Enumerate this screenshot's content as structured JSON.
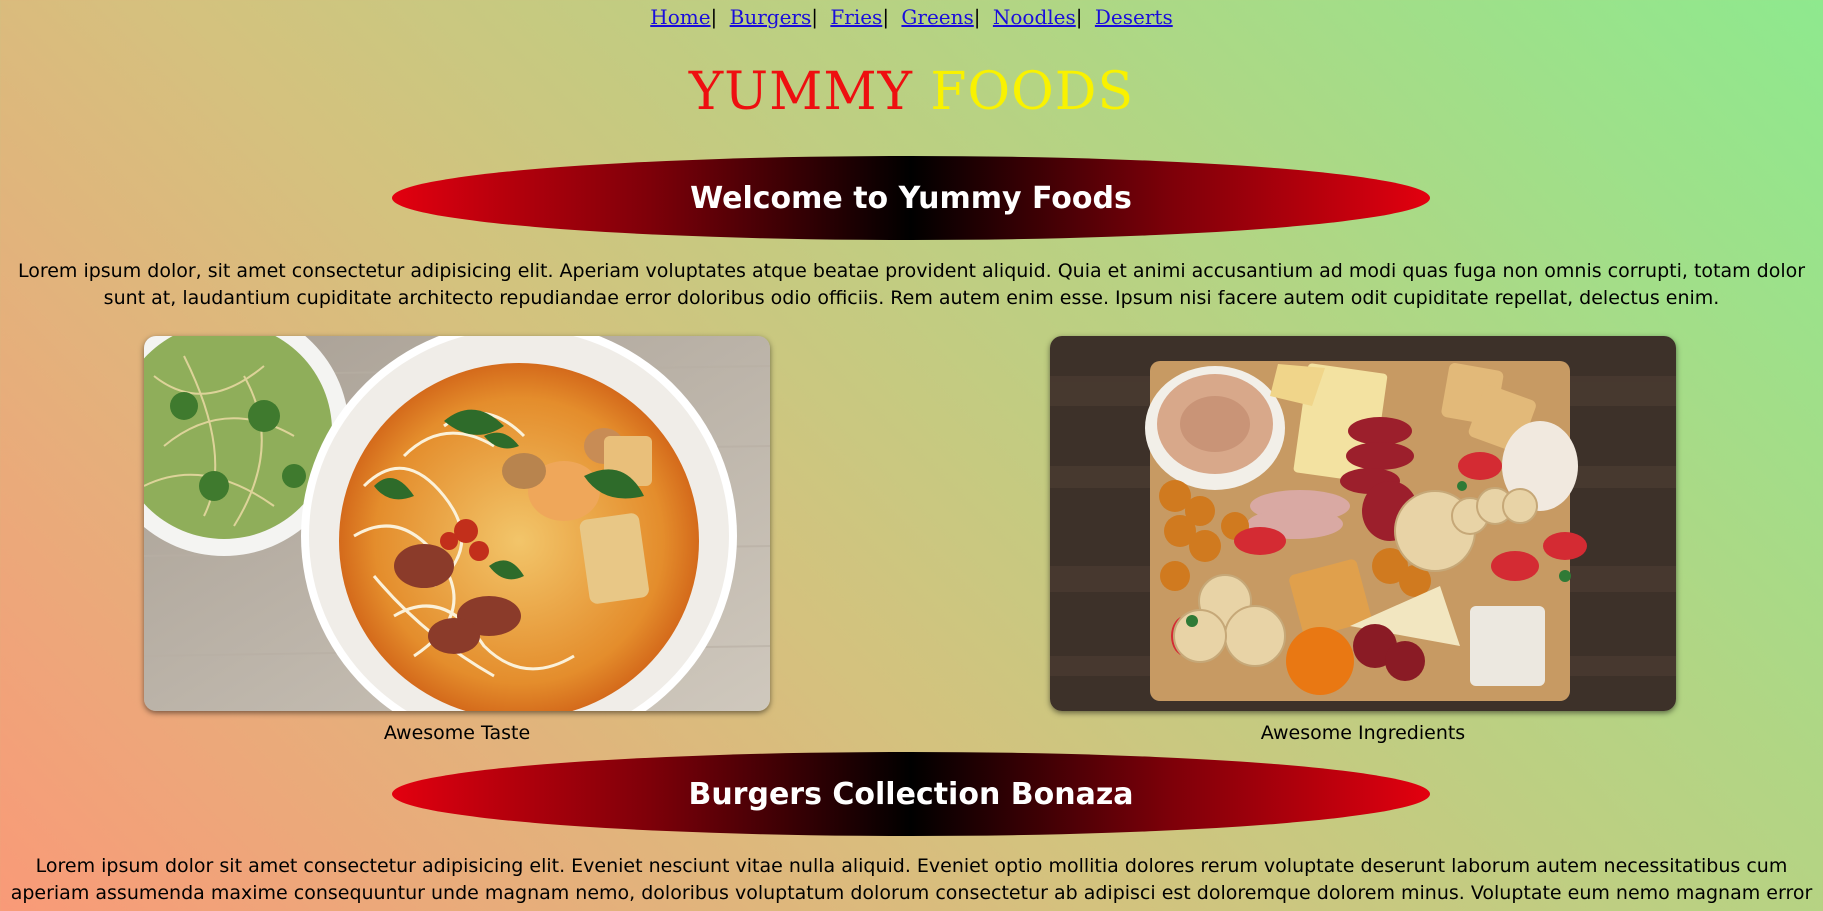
{
  "nav": {
    "items": [
      {
        "label": "Home"
      },
      {
        "label": "Burgers"
      },
      {
        "label": "Fries"
      },
      {
        "label": "Greens"
      },
      {
        "label": "Noodles"
      },
      {
        "label": "Deserts"
      }
    ],
    "separator": "|"
  },
  "logo": {
    "word1": "YUMMY",
    "word2": "FOODS",
    "word1_color": "#ee0f10",
    "word2_color": "#f9f200"
  },
  "sections": [
    {
      "heading": "Welcome to Yummy Foods",
      "text": "Lorem ipsum dolor, sit amet consectetur adipisicing elit. Aperiam voluptates atque beatae provident aliquid. Quia et animi accusantium ad modi quas fuga non omnis corrupti, totam dolor sunt at, laudantium cupiditate architecto repudiandae error doloribus odio officiis. Rem autem enim esse. Ipsum nisi facere autem odit cupiditate repellat, delectus enim."
    },
    {
      "heading": "Burgers Collection Bonaza",
      "text": "Lorem ipsum dolor sit amet consectetur adipisicing elit. Eveniet nesciunt vitae nulla aliquid. Eveniet optio mollitia dolores rerum voluptate deserunt laborum autem necessitatibus cum aperiam assumenda maxime consequuntur unde magnam nemo, doloribus voluptatum dolorum consectetur ab adipisci est doloremque dolorem minus. Voluptate eum nemo magnam error velit impedit odio"
    }
  ],
  "gallery": [
    {
      "image": "noodle-soup-bowl",
      "caption": "Awesome Taste"
    },
    {
      "image": "charcuterie-board",
      "caption": "Awesome Ingredients"
    }
  ],
  "colors": {
    "banner_edge": "#e3000f",
    "banner_center": "#000000",
    "link": "#1a0ddb"
  }
}
